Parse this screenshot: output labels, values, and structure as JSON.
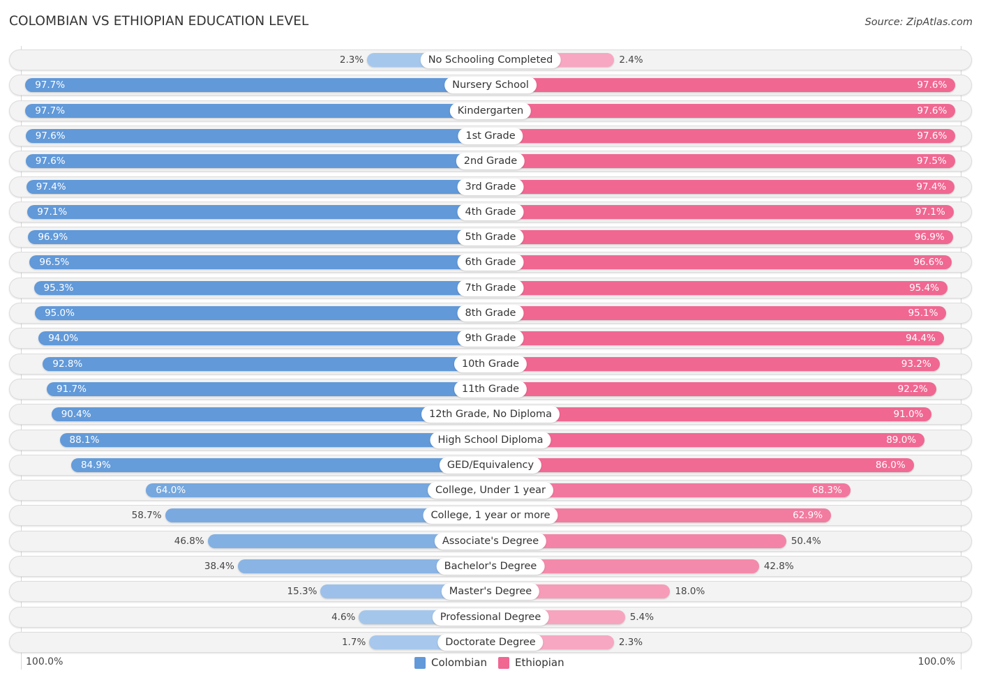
{
  "header": {
    "title": "COLOMBIAN VS ETHIOPIAN EDUCATION LEVEL",
    "source": "Source: ZipAtlas.com"
  },
  "colors": {
    "colombian_strong": "#6199d9",
    "colombian_light": "#a8c8ec",
    "ethiopian_strong": "#f06792",
    "ethiopian_light": "#f7a9c2"
  },
  "chart_data": {
    "type": "bar",
    "orientation": "horizontal-diverging",
    "title": "COLOMBIAN VS ETHIOPIAN EDUCATION LEVEL",
    "source": "Source: ZipAtlas.com",
    "xlabel": "",
    "ylabel": "",
    "axis_min_label": "100.0%",
    "axis_max_label": "100.0%",
    "xlim": [
      0,
      100
    ],
    "unit": "%",
    "legend_position": "bottom-center",
    "categories": [
      "No Schooling Completed",
      "Nursery School",
      "Kindergarten",
      "1st Grade",
      "2nd Grade",
      "3rd Grade",
      "4th Grade",
      "5th Grade",
      "6th Grade",
      "7th Grade",
      "8th Grade",
      "9th Grade",
      "10th Grade",
      "11th Grade",
      "12th Grade, No Diploma",
      "High School Diploma",
      "GED/Equivalency",
      "College, Under 1 year",
      "College, 1 year or more",
      "Associate's Degree",
      "Bachelor's Degree",
      "Master's Degree",
      "Professional Degree",
      "Doctorate Degree"
    ],
    "series": [
      {
        "name": "Colombian",
        "side": "left",
        "values": [
          2.3,
          97.7,
          97.7,
          97.6,
          97.6,
          97.4,
          97.1,
          96.9,
          96.5,
          95.3,
          95.0,
          94.0,
          92.8,
          91.7,
          90.4,
          88.1,
          84.9,
          64.0,
          58.7,
          46.8,
          38.4,
          15.3,
          4.6,
          1.7
        ],
        "labels": [
          "2.3%",
          "97.7%",
          "97.7%",
          "97.6%",
          "97.6%",
          "97.4%",
          "97.1%",
          "96.9%",
          "96.5%",
          "95.3%",
          "95.0%",
          "94.0%",
          "92.8%",
          "91.7%",
          "90.4%",
          "88.1%",
          "84.9%",
          "64.0%",
          "58.7%",
          "46.8%",
          "38.4%",
          "15.3%",
          "4.6%",
          "1.7%"
        ]
      },
      {
        "name": "Ethiopian",
        "side": "right",
        "values": [
          2.4,
          97.6,
          97.6,
          97.6,
          97.5,
          97.4,
          97.1,
          96.9,
          96.6,
          95.4,
          95.1,
          94.4,
          93.2,
          92.2,
          91.0,
          89.0,
          86.0,
          68.3,
          62.9,
          50.4,
          42.8,
          18.0,
          5.4,
          2.3
        ],
        "labels": [
          "2.4%",
          "97.6%",
          "97.6%",
          "97.6%",
          "97.5%",
          "97.4%",
          "97.1%",
          "96.9%",
          "96.6%",
          "95.4%",
          "95.1%",
          "94.4%",
          "93.2%",
          "92.2%",
          "91.0%",
          "89.0%",
          "86.0%",
          "68.3%",
          "62.9%",
          "50.4%",
          "42.8%",
          "18.0%",
          "5.4%",
          "2.3%"
        ]
      }
    ]
  },
  "legend": {
    "items": [
      {
        "label": "Colombian",
        "color": "#6199d9"
      },
      {
        "label": "Ethiopian",
        "color": "#f06792"
      }
    ]
  }
}
